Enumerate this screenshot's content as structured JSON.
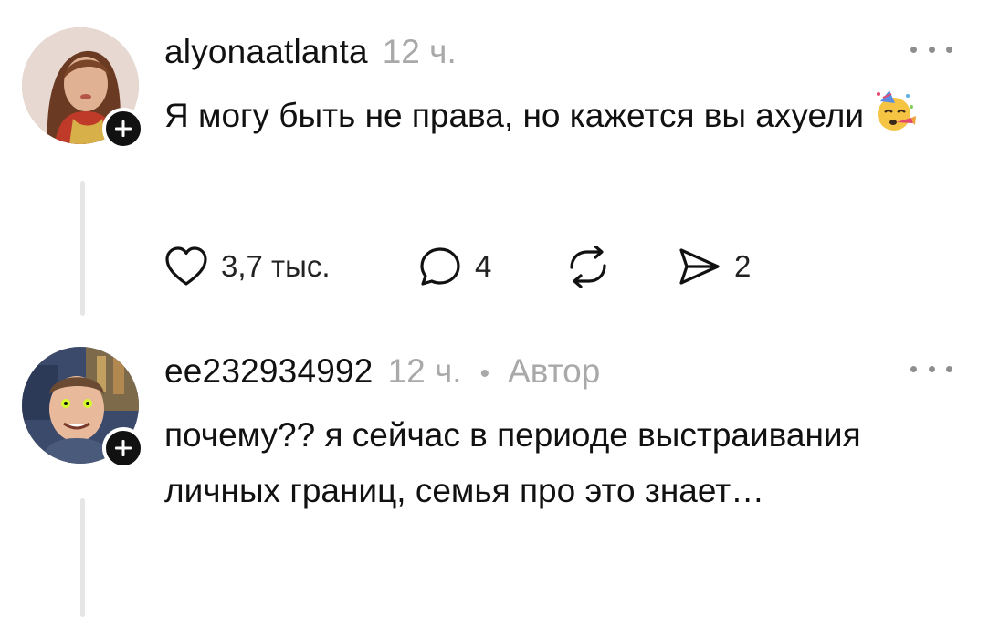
{
  "comments": [
    {
      "username": "alyonaatlanta",
      "time": "12 ч.",
      "text": "Я могу быть не права, но кажется вы ахуели",
      "emoji": "partying-face",
      "likes": "3,7 тыс.",
      "replies": "4",
      "shares": "2"
    },
    {
      "username": "ee232934992",
      "time": "12 ч.",
      "separator": "•",
      "author_label": "Автор",
      "text": "почему?? я сейчас в периоде выстраивания личных границ, семья про это знает…"
    }
  ]
}
